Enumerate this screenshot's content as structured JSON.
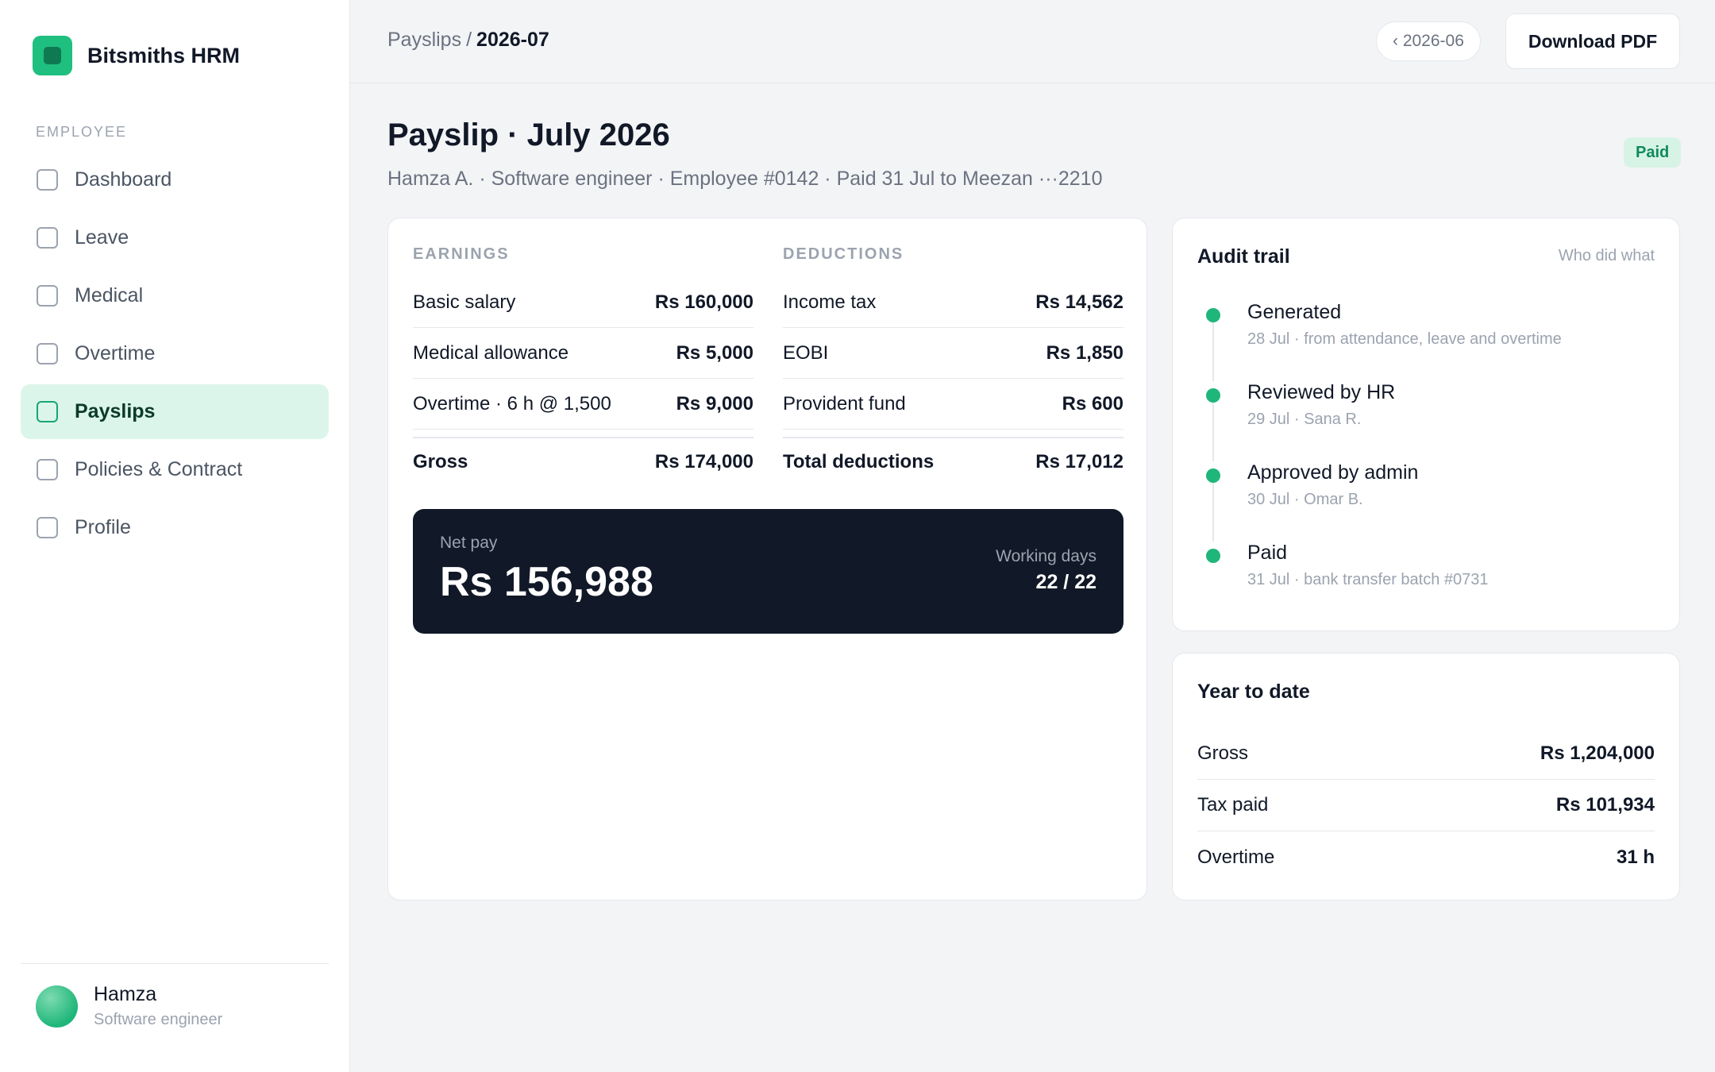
{
  "app": {
    "name": "Bitsmiths HRM"
  },
  "sidebar": {
    "section_label": "EMPLOYEE",
    "items": [
      {
        "label": "Dashboard",
        "active": false
      },
      {
        "label": "Leave",
        "active": false
      },
      {
        "label": "Medical",
        "active": false
      },
      {
        "label": "Overtime",
        "active": false
      },
      {
        "label": "Payslips",
        "active": true
      },
      {
        "label": "Policies & Contract",
        "active": false
      },
      {
        "label": "Profile",
        "active": false
      }
    ],
    "user": {
      "name": "Hamza",
      "role": "Software engineer"
    }
  },
  "header": {
    "breadcrumb_parent": "Payslips",
    "breadcrumb_separator": "/",
    "breadcrumb_current": "2026-07",
    "prev_label": "‹ 2026-06",
    "download_label": "Download PDF"
  },
  "page": {
    "title": "Payslip · July 2026",
    "subtitle": "Hamza A. · Software engineer · Employee #0142 · Paid 31 Jul to Meezan ···2210",
    "status": "Paid"
  },
  "earnings": {
    "heading": "EARNINGS",
    "rows": [
      {
        "label": "Basic salary",
        "value": "Rs 160,000"
      },
      {
        "label": "Medical allowance",
        "value": "Rs 5,000"
      },
      {
        "label": "Overtime · 6 h @ 1,500",
        "value": "Rs 9,000"
      }
    ],
    "total_label": "Gross",
    "total_value": "Rs 174,000"
  },
  "deductions": {
    "heading": "DEDUCTIONS",
    "rows": [
      {
        "label": "Income tax",
        "value": "Rs 14,562"
      },
      {
        "label": "EOBI",
        "value": "Rs 1,850"
      },
      {
        "label": "Provident fund",
        "value": "Rs 600"
      }
    ],
    "total_label": "Total deductions",
    "total_value": "Rs 17,012"
  },
  "net_pay": {
    "label": "Net pay",
    "value": "Rs 156,988",
    "working_days_label": "Working days",
    "working_days_value": "22 / 22"
  },
  "audit": {
    "title": "Audit trail",
    "hint": "Who did what",
    "events": [
      {
        "title": "Generated",
        "meta": "28 Jul · from attendance, leave and overtime"
      },
      {
        "title": "Reviewed by HR",
        "meta": "29 Jul · Sana R."
      },
      {
        "title": "Approved by admin",
        "meta": "30 Jul · Omar B."
      },
      {
        "title": "Paid",
        "meta": "31 Jul · bank transfer batch #0731"
      }
    ]
  },
  "ytd": {
    "title": "Year to date",
    "rows": [
      {
        "label": "Gross",
        "value": "Rs 1,204,000"
      },
      {
        "label": "Tax paid",
        "value": "Rs 101,934"
      },
      {
        "label": "Overtime",
        "value": "31 h"
      }
    ]
  },
  "colors": {
    "accent": "#1fb67a",
    "active_bg": "#dcf5ea",
    "netpay_bg": "#111827",
    "badge_bg": "#d7f3e6",
    "badge_text": "#0f8a5e"
  }
}
